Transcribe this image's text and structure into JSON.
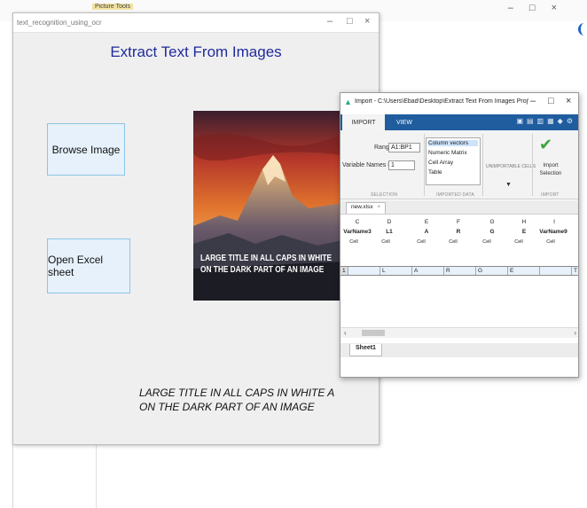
{
  "background_app": {
    "tab_tag": "Picture Tools",
    "controls": [
      "–",
      "□",
      "×"
    ]
  },
  "figure": {
    "window_title": "text_recognition_using_ocr",
    "controls": [
      "–",
      "□",
      "×"
    ],
    "heading": "Extract Text From Images",
    "browse_button": "Browse Image",
    "excel_button": "Open Excel sheet",
    "image_text_line1": "LARGE TITLE IN ALL CAPS IN WHITE",
    "image_text_line2": "ON THE DARK PART OF AN IMAGE",
    "caption_line1": "LARGE TITLE IN ALL CAPS IN WHITE A",
    "caption_line2": "ON THE DARK PART OF AN IMAGE"
  },
  "import_dialog": {
    "title": "Import - C:\\Users\\Ebad\\Desktop\\Extract Text From Images Proj\\How to ex...",
    "controls": [
      "–",
      "□",
      "×"
    ],
    "tabs": [
      "IMPORT",
      "VIEW"
    ],
    "range_label": "Range:",
    "range_value": "A1:BP1",
    "varnames_label": "Variable Names Row:",
    "varnames_value": "1",
    "selection_section": "SELECTION",
    "output_types": [
      "Column vectors",
      "Numeric Matrix",
      "Cell Array",
      "Table"
    ],
    "imported_data_section": "IMPORTED DATA",
    "unimportable_label": "UNIMPORTABLE CELLS",
    "import_button_line1": "Import",
    "import_button_line2": "Selection",
    "import_section": "IMPORT",
    "file_tab": "new.xlsx",
    "columns": [
      {
        "letter": "C",
        "name": "VarName3",
        "type": "Cell"
      },
      {
        "letter": "D",
        "name": "L1",
        "type": "Cell"
      },
      {
        "letter": "E",
        "name": "A",
        "type": "Cell"
      },
      {
        "letter": "F",
        "name": "R",
        "type": "Cell"
      },
      {
        "letter": "G",
        "name": "G",
        "type": "Cell"
      },
      {
        "letter": "H",
        "name": "E",
        "type": "Cell"
      },
      {
        "letter": "I",
        "name": "VarName9",
        "type": "Cell"
      }
    ],
    "row_number": "1",
    "row_values": [
      "",
      "L",
      "A",
      "R",
      "G",
      "E",
      "",
      "T"
    ],
    "sheet_tab": "Sheet1"
  }
}
